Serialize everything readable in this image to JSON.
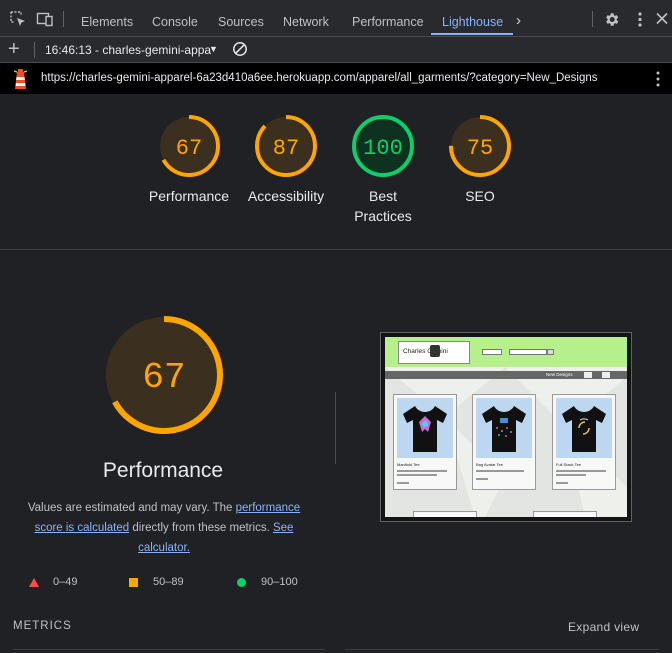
{
  "devtools": {
    "tabs": [
      {
        "label": "Elements"
      },
      {
        "label": "Console"
      },
      {
        "label": "Sources"
      },
      {
        "label": "Network"
      },
      {
        "label": "Performance"
      },
      {
        "label": "Lighthouse",
        "active": true
      }
    ],
    "icons": {
      "inspect": "inspect-element-icon",
      "device": "device-toolbar-icon",
      "more_tabs": "more-tabs-icon",
      "settings": "gear-icon",
      "menu": "kebab-menu-icon"
    },
    "accent_color": "#8ab4f8"
  },
  "toolbar": {
    "report_label": "16:46:13 - charles-gemini-appa",
    "new_report_icon": "plus-icon",
    "clear_icon": "clear-icon"
  },
  "url_bar": {
    "url": "https://charles-gemini-apparel-6a23d410a6ee.herokuapp.com/apparel/all_garments/?category=New_Designs",
    "logo_icon": "lighthouse-icon"
  },
  "categories": [
    {
      "label": "Performance",
      "score": 67,
      "status": "average"
    },
    {
      "label": "Accessibility",
      "score": 87,
      "status": "average"
    },
    {
      "label_line1": "Best",
      "label_line2": "Practices",
      "score": 100,
      "status": "pass"
    },
    {
      "label": "SEO",
      "score": 75,
      "status": "average"
    }
  ],
  "status_colors": {
    "fail": "#ff4e42",
    "average": "#ffa400",
    "pass": "#0cce6b"
  },
  "performance": {
    "score": 67,
    "title": "Performance",
    "desc_prefix": "Values are estimated and may vary. The ",
    "desc_link1": "performance score is calculated",
    "desc_middle": " directly from these metrics. ",
    "desc_link2": "See calculator."
  },
  "legend": [
    {
      "range": "0–49",
      "shape": "triangle"
    },
    {
      "range": "50–89",
      "shape": "square"
    },
    {
      "range": "90–100",
      "shape": "circle"
    }
  ],
  "metrics": {
    "label": "METRICS",
    "expand": "Expand view"
  },
  "thumbnail": {
    "logo_text": "Charles   Gemini",
    "nav_text": "New Designs",
    "products": [
      {
        "name": "Manifold Tee"
      },
      {
        "name": "Bag Avatar Tee"
      },
      {
        "name": "Full Stack Tee"
      }
    ]
  }
}
